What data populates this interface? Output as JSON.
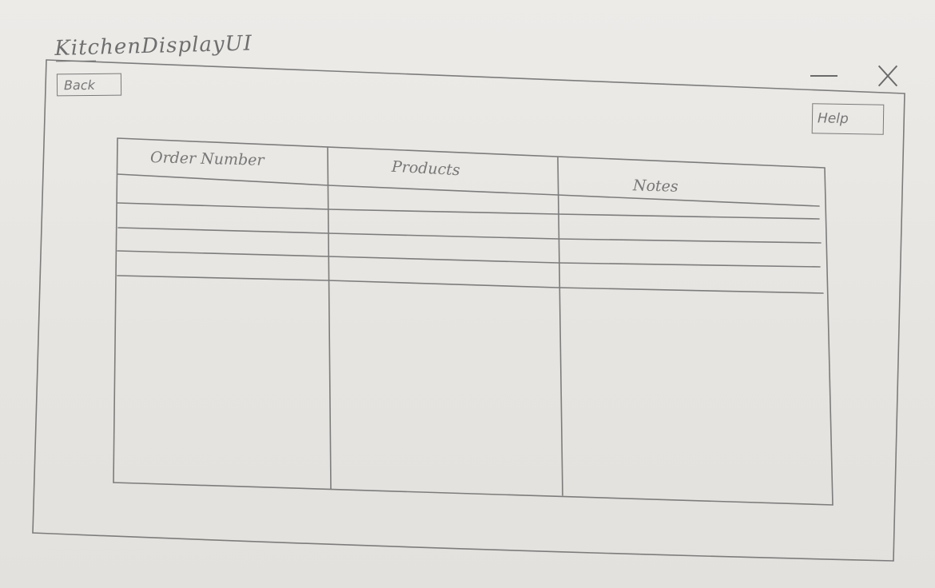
{
  "window": {
    "title": "KitchenDisplayUI",
    "back_label": "Back",
    "help_label": "Help"
  },
  "table": {
    "columns": [
      "Order Number",
      "Products",
      "Notes"
    ],
    "rows": [
      [
        "",
        "",
        ""
      ],
      [
        "",
        "",
        ""
      ],
      [
        "",
        "",
        ""
      ],
      [
        "",
        "",
        ""
      ]
    ]
  }
}
